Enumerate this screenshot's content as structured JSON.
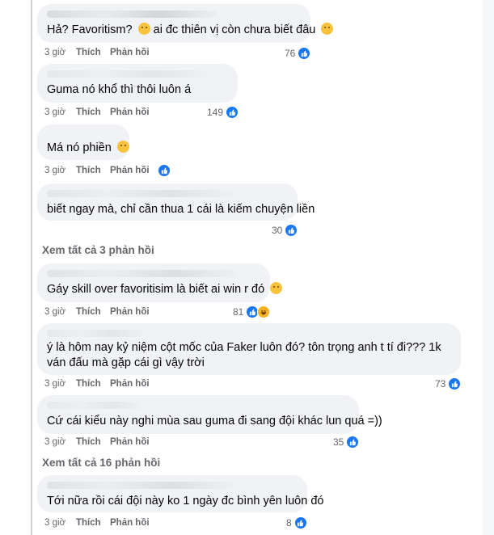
{
  "comments": [
    {
      "text_pre": "Hả? Favoritism?",
      "text_post": "ai đc thiên vị còn chưa biết đâu",
      "emoji1": "confused-face-icon",
      "emoji2": "pensive-face-icon",
      "time": "3 giờ",
      "like": "Thích",
      "reply": "Phản hồi",
      "count": "76"
    },
    {
      "text": "Guma nó khổ thì thôi luôn á",
      "time": "3 giờ",
      "like": "Thích",
      "reply": "Phản hồi",
      "count": "149"
    },
    {
      "text": "Má nó phiền",
      "emoji": "slightly-smiling-face-icon",
      "time": "3 giờ",
      "like": "Thích",
      "reply": "Phản hồi",
      "count": ""
    },
    {
      "text": "biết ngay mà, chỉ cần thua 1 cái là kiếm chuyện liền",
      "count": "30"
    },
    {
      "text": "Gáy skill over favoritisim là biết ai win r đó",
      "emoji": "laughing-face-icon",
      "time": "3 giờ",
      "like": "Thích",
      "reply": "Phản hồi",
      "count": "81"
    },
    {
      "text": "ý là hôm nay kỷ niệm cột mốc của Faker luôn đó? tôn trọng anh t tí đi??? 1k ván đấu mà gặp cái gì vậy trời",
      "time": "3 giờ",
      "like": "Thích",
      "reply": "Phản hồi",
      "count": "73"
    },
    {
      "text": "Cứ cái kiểu này nghi mùa sau guma đi sang đội khác lun quá =))",
      "time": "3 giờ",
      "like": "Thích",
      "reply": "Phản hồi",
      "count": "35"
    },
    {
      "text": "Tới nữa rồi cái đội này ko 1 ngày đc bình yên luôn đó",
      "time": "3 giờ",
      "like": "Thích",
      "reply": "Phản hồi",
      "count": "8"
    }
  ],
  "view_more_1": "Xem tất cả 3 phản hồi",
  "view_more_2": "Xem tất cả 16 phản hồi",
  "colors": {
    "like_blue": "#1877f2",
    "bubble": "#f0f2f5",
    "meta": "#65676b"
  }
}
